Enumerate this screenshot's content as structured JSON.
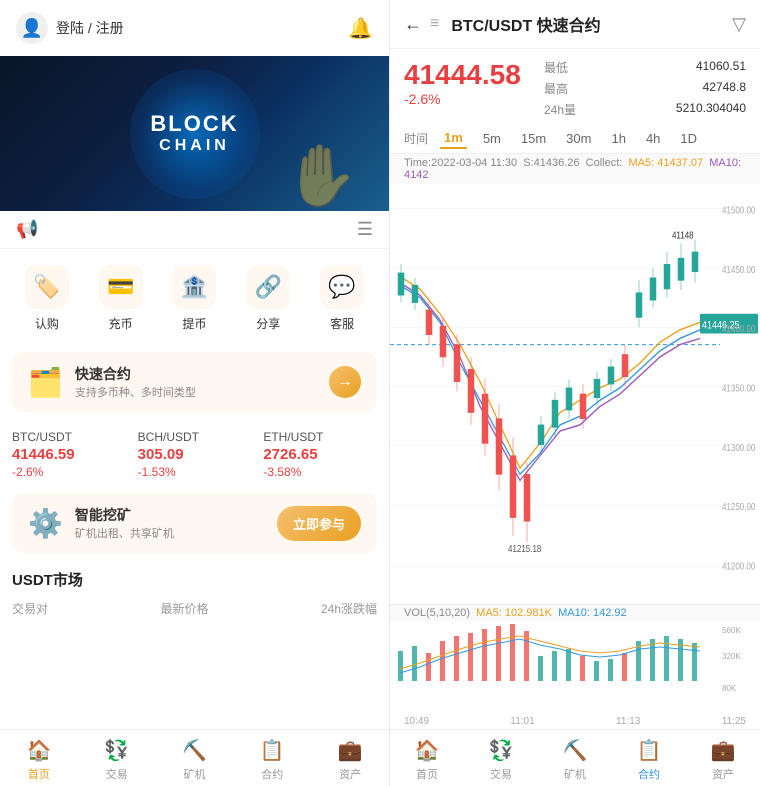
{
  "left": {
    "header": {
      "login_label": "登陆 / 注册",
      "bell_icon": "🔔"
    },
    "banner": {
      "block_text": "BLOCK",
      "chain_text": "CHAIN"
    },
    "menu_items": [
      {
        "icon": "🏷️",
        "label": "认购"
      },
      {
        "icon": "💳",
        "label": "充币"
      },
      {
        "icon": "🏦",
        "label": "提币"
      },
      {
        "icon": "🔗",
        "label": "分享"
      },
      {
        "icon": "💬",
        "label": "客服"
      }
    ],
    "quick_contract": {
      "title": "快速合约",
      "subtitle": "支持多币种、多时间类型",
      "arrow": "→"
    },
    "prices": [
      {
        "pair": "BTC/USDT",
        "value": "41446.59",
        "change": "-2.6%"
      },
      {
        "pair": "BCH/USDT",
        "value": "305.09",
        "change": "-1.53%"
      },
      {
        "pair": "ETH/USDT",
        "value": "2726.65",
        "change": "-3.58%"
      }
    ],
    "mining": {
      "title": "智能挖矿",
      "subtitle": "矿机出租、共享矿机",
      "button": "立即参与"
    },
    "market": {
      "title": "USDT市场",
      "col1": "交易对",
      "col2": "最新价格",
      "col3": "24h涨跌幅"
    },
    "bottom_nav": [
      {
        "icon": "🏠",
        "label": "首页",
        "active": true
      },
      {
        "icon": "💱",
        "label": "交易",
        "active": false
      },
      {
        "icon": "⛏️",
        "label": "矿机",
        "active": false
      },
      {
        "icon": "📋",
        "label": "合约",
        "active": false
      },
      {
        "icon": "💼",
        "label": "资产",
        "active": false
      }
    ]
  },
  "right": {
    "header": {
      "back": "←",
      "menu_icon": "≡",
      "title": "BTC/USDT 快速合约",
      "filter_icon": "▽"
    },
    "price": {
      "main": "41444.58",
      "change": "-2.6%",
      "low_label": "最低",
      "low_value": "41060.51",
      "high_label": "最高",
      "high_value": "42748.8",
      "vol_label": "24h量",
      "vol_value": "5210.304040"
    },
    "time_tabs": {
      "label": "时间",
      "tabs": [
        "1m",
        "5m",
        "15m",
        "30m",
        "1h",
        "4h",
        "1D"
      ],
      "active": "1m"
    },
    "ma_info": {
      "time": "Time:2022-03-04 11:30",
      "s_value": "S:41436.26",
      "collect": "Collect:",
      "ma5_label": "MA5:",
      "ma5_value": "41437.07",
      "ma10_label": "MA10:",
      "ma10_value": "4142"
    },
    "chart": {
      "y_labels": [
        "41500.00",
        "41450.00",
        "41400.00",
        "41350.00",
        "41300.00",
        "41250.00",
        "41200.00"
      ],
      "price_badge": "41446.25",
      "price_min": "41215.18",
      "price_max": "41148"
    },
    "volume": {
      "vol_info": "VOL(5,10,20)",
      "ma5_label": "MA5:",
      "ma5_value": "102.981K",
      "ma10_label": "MA10:",
      "ma10_value": "142.92",
      "vol_labels": [
        "560K",
        "320K",
        "80K"
      ]
    },
    "time_labels": [
      "10:49",
      "11:01",
      "11:13",
      "11:25"
    ],
    "bottom_nav": [
      {
        "icon": "🏠",
        "label": "首页",
        "active": false
      },
      {
        "icon": "💱",
        "label": "交易",
        "active": false
      },
      {
        "icon": "⛏️",
        "label": "矿机",
        "active": false
      },
      {
        "icon": "📋",
        "label": "合约",
        "active": true
      },
      {
        "icon": "💼",
        "label": "资产",
        "active": false
      }
    ]
  }
}
